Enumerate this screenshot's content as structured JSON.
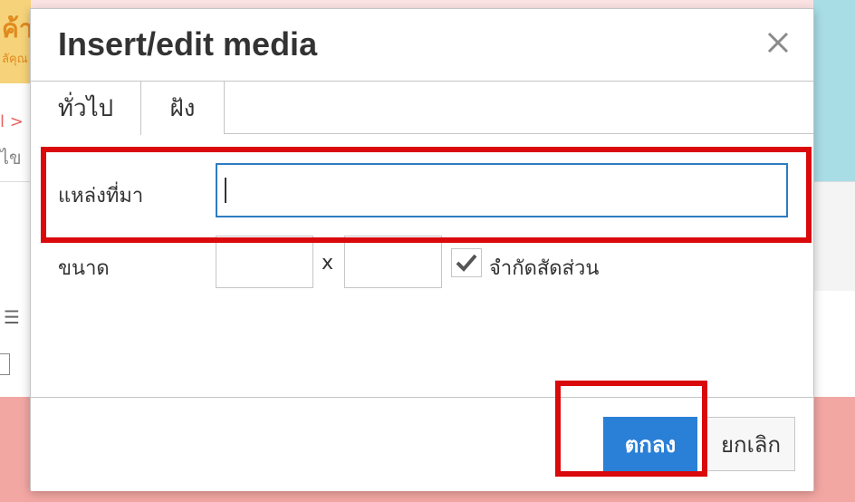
{
  "background": {
    "corner_text": "ค้า",
    "corner_subtext": "ลัคุณ",
    "breadcrumb_text": "l >",
    "side_text": "ไข"
  },
  "dialog": {
    "title": "Insert/edit media",
    "close_icon": "close-icon",
    "tabs": [
      {
        "label": "ทั่วไป",
        "active": true
      },
      {
        "label": "ฝัง",
        "active": false
      }
    ],
    "source": {
      "label": "แหล่งที่มา",
      "value": "",
      "placeholder": ""
    },
    "dimensions": {
      "label": "ขนาด",
      "width_value": "",
      "height_value": "",
      "separator": "x",
      "constrain_label": "จำกัดสัดส่วน",
      "constrain_checked": true
    },
    "buttons": {
      "ok_label": "ตกลง",
      "cancel_label": "ยกเลิก"
    }
  },
  "colors": {
    "primary_button": "#2a80d6",
    "input_focus_border": "#2d7cc1",
    "highlight": "#d9090c"
  }
}
